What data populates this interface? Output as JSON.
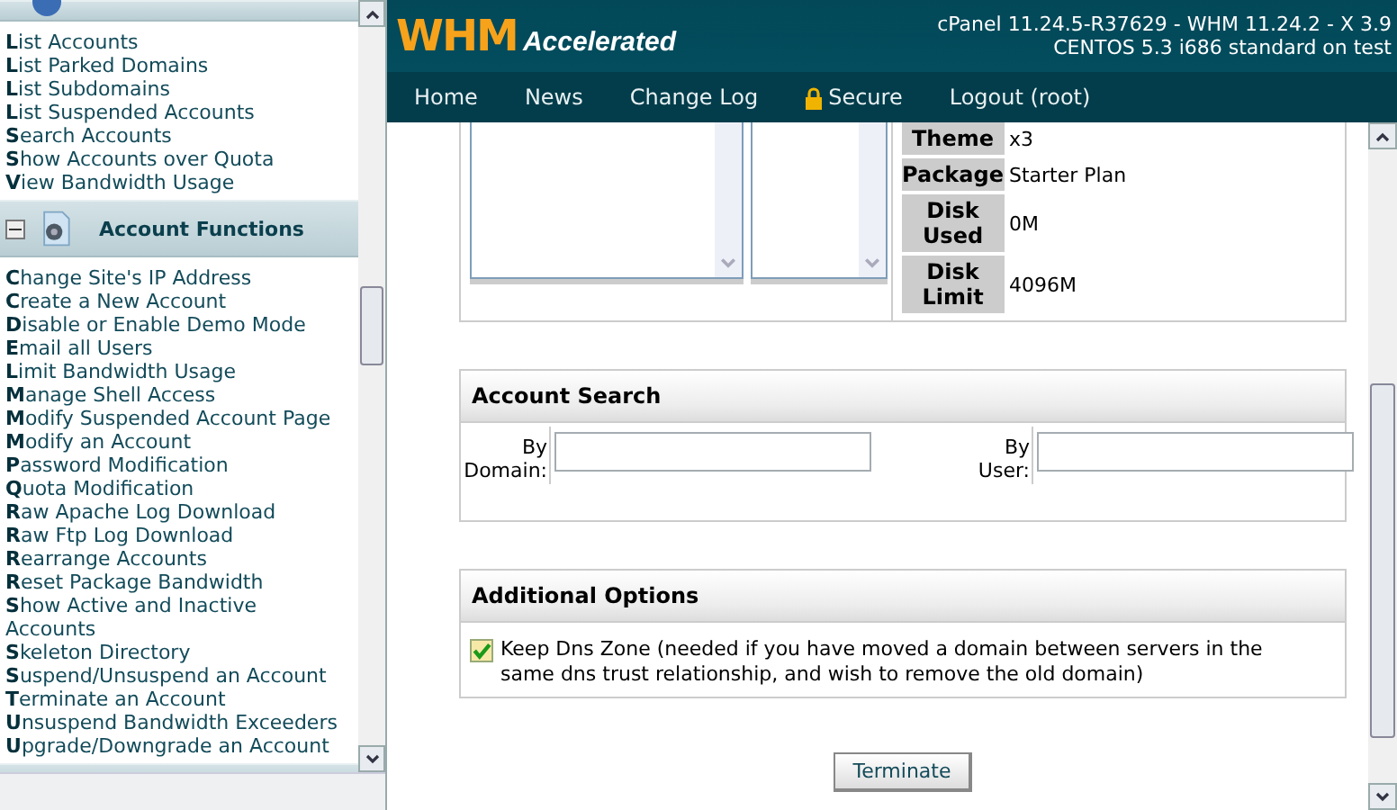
{
  "sidebar": {
    "top_items": [
      {
        "label": "**L**ist Accounts"
      },
      {
        "label": "**L**ist Parked Domains"
      },
      {
        "label": "**L**ist Subdomains"
      },
      {
        "label": "**L**ist Suspended Accounts"
      },
      {
        "label": "**S**earch Accounts"
      },
      {
        "label": "**S**how Accounts over Quota"
      },
      {
        "label": "**V**iew Bandwidth Usage"
      }
    ],
    "section": {
      "title": "Account Functions",
      "expanded": true
    },
    "items": [
      {
        "label": "**C**hange Site's IP Address"
      },
      {
        "label": "**C**reate a New Account"
      },
      {
        "label": "**D**isable or Enable Demo Mode"
      },
      {
        "label": "**E**mail all Users"
      },
      {
        "label": "**L**imit Bandwidth Usage"
      },
      {
        "label": "**M**anage Shell Access"
      },
      {
        "label": "**M**odify Suspended Account Page"
      },
      {
        "label": "**M**odify an Account"
      },
      {
        "label": "**P**assword Modification"
      },
      {
        "label": "**Q**uota Modification"
      },
      {
        "label": "**R**aw Apache Log Download"
      },
      {
        "label": "**R**aw Ftp Log Download"
      },
      {
        "label": "**R**earrange Accounts"
      },
      {
        "label": "**R**eset Package Bandwidth"
      },
      {
        "label": "**S**how Active and Inactive Accounts"
      },
      {
        "label": "**S**keleton Directory"
      },
      {
        "label": "**S**uspend/Unsuspend an Account"
      },
      {
        "label": "**T**erminate an Account"
      },
      {
        "label": "**U**nsuspend Bandwidth Exceeders"
      },
      {
        "label": "**U**pgrade/Downgrade an Account"
      }
    ]
  },
  "header": {
    "logo_main": "WHM",
    "logo_sub": "Accelerated",
    "version_lines": [
      "cPanel 11.24.5-R37629 - WHM 11.24.2 - X 3.9",
      "CENTOS 5.3 i686 standard on test"
    ]
  },
  "nav": [
    {
      "label": "Home",
      "kind": "link"
    },
    {
      "label": "News",
      "kind": "link"
    },
    {
      "label": "Change Log",
      "kind": "link"
    },
    {
      "label": "Secure",
      "kind": "lock"
    },
    {
      "label": "Logout (root)",
      "kind": "link"
    }
  ],
  "account_info": [
    {
      "label": "Theme",
      "value": "x3"
    },
    {
      "label": "Package",
      "value": "Starter Plan"
    },
    {
      "label": "Disk Used",
      "value": "0M"
    },
    {
      "label": "Disk Limit",
      "value": "4096M"
    }
  ],
  "account_search": {
    "title": "Account Search",
    "fields": [
      {
        "label": "By Domain:"
      },
      {
        "label": "By User:"
      }
    ]
  },
  "additional_options": {
    "title": "Additional Options",
    "option": {
      "label": "Keep Dns Zone (needed if you have moved a domain between servers in the same dns trust relationship, and wish to remove the old domain)",
      "checked": true
    }
  },
  "submit": "Terminate"
}
